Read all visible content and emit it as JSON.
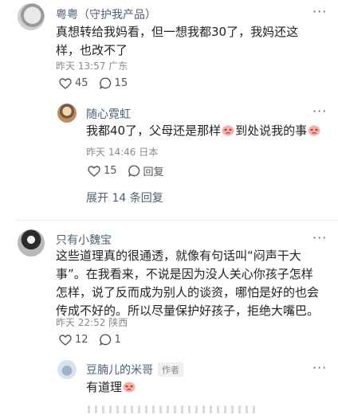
{
  "comments": [
    {
      "user": "粤粤（守护我产品）",
      "text": "真想转给我妈看，但一想我都30了，我妈还这样，也改不了",
      "time": "昨天 13:57",
      "location": "广东",
      "likes": "45",
      "replies": "15",
      "sub_reply": {
        "user": "随心霓虹",
        "text_1": "我都40了，父母还是那样",
        "text_2": "到处说我的事",
        "time": "昨天 14:46",
        "location": "日本",
        "likes": "15",
        "reply_label": "回复"
      },
      "expand_label": "展开 14 条回复"
    },
    {
      "user": "只有小魏宝",
      "text": "这些道理真的很通透，就像有句话叫“闷声干大事”。在我看来，不说是因为没人关心你孩子怎样怎样，说了反而成为别人的谈资，哪怕是好的也会传成不好的。所以尽量保护好孩子，拒绝大嘴巴。",
      "time": "昨天 22:52",
      "location": "陕西",
      "likes": "12",
      "replies": "1",
      "sub_reply": {
        "user": "豆腩儿的米哥",
        "author_tag": "作者",
        "text": "有道理"
      }
    }
  ],
  "icons": {
    "more": "more-dots-icon",
    "like": "heart-outline-icon",
    "reply": "comment-bubble-icon",
    "emoji": "crying-face-emoji"
  },
  "colors": {
    "name": "#4d5f75",
    "meta": "#8a8a8a",
    "text": "#222222"
  }
}
